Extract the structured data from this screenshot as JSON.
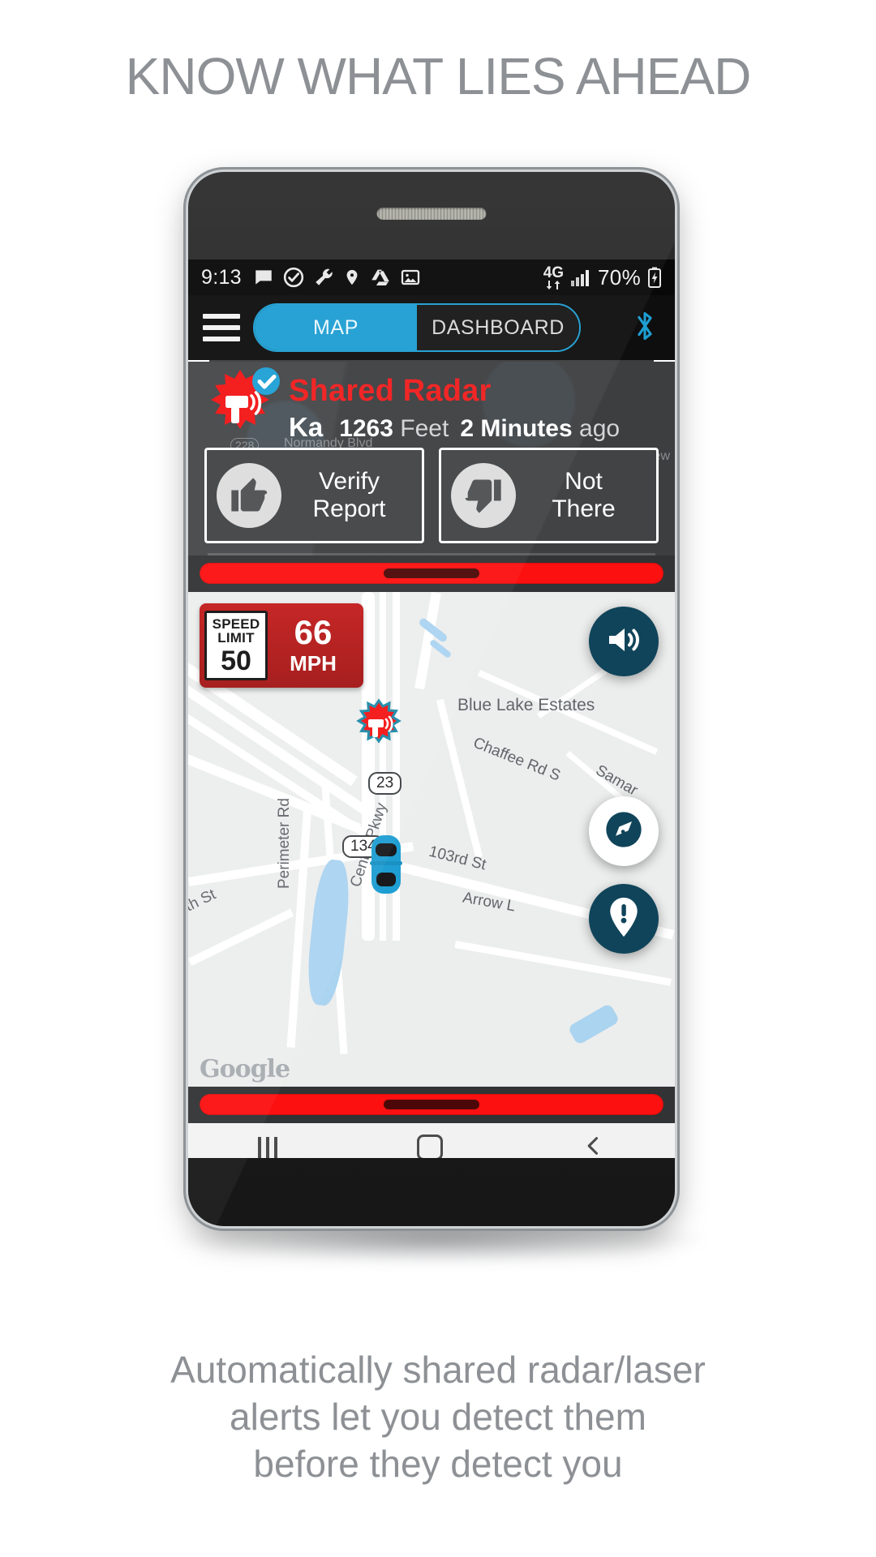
{
  "headline": "KNOW WHAT LIES AHEAD",
  "caption": {
    "line1": "Automatically shared radar/laser",
    "line2": "alerts let you detect them",
    "line3": "before they detect you"
  },
  "statusbar": {
    "time": "9:13",
    "network": "4G",
    "battery_percent": "70%",
    "icons": [
      "message-icon",
      "check-circle-icon",
      "wrench-icon",
      "location-pin-icon",
      "drive-icon",
      "gallery-icon",
      "signal-bars-icon",
      "battery-charging-icon"
    ]
  },
  "toolbar": {
    "menu_label": "menu",
    "tabs": [
      {
        "label": "MAP",
        "active": true
      },
      {
        "label": "DASHBOARD",
        "active": false
      }
    ],
    "bluetooth_label": "bluetooth",
    "accent_color": "#1b9dd1"
  },
  "alert": {
    "title": "Shared Radar",
    "band": "Ka",
    "distance_value": "1263",
    "distance_unit": "Feet",
    "time_value": "2 Minutes",
    "time_suffix": "ago",
    "title_color": "#f01a1a",
    "verify_button": {
      "line1": "Verify",
      "line2": "Report"
    },
    "not_there_button": {
      "line1": "Not",
      "line2": "There"
    },
    "ghost_streets": [
      "Normandy Blvd",
      "228",
      "ew"
    ]
  },
  "speed": {
    "limit_title_line1": "SPEED",
    "limit_title_line2": "LIMIT",
    "limit_value": "50",
    "current_value": "66",
    "current_unit": "MPH"
  },
  "map": {
    "labels": [
      {
        "text": "Blue Lake Estates"
      },
      {
        "text": "Chaffee Rd S"
      },
      {
        "text": "Samar"
      },
      {
        "text": "103rd St"
      },
      {
        "text": "Perimeter Rd"
      },
      {
        "text": "th St"
      },
      {
        "text": "Arrow L"
      }
    ],
    "shields": [
      "23",
      "134"
    ],
    "watermark": "Google",
    "buttons": [
      {
        "name": "volume-button",
        "icon": "speaker-icon"
      },
      {
        "name": "compass-button",
        "icon": "compass-icon"
      },
      {
        "name": "report-button",
        "icon": "alert-pin-icon"
      }
    ],
    "markers": [
      "radar-marker",
      "vehicle-marker"
    ]
  },
  "navbar": {
    "recents_label": "recents",
    "home_label": "home",
    "back_label": "back"
  }
}
